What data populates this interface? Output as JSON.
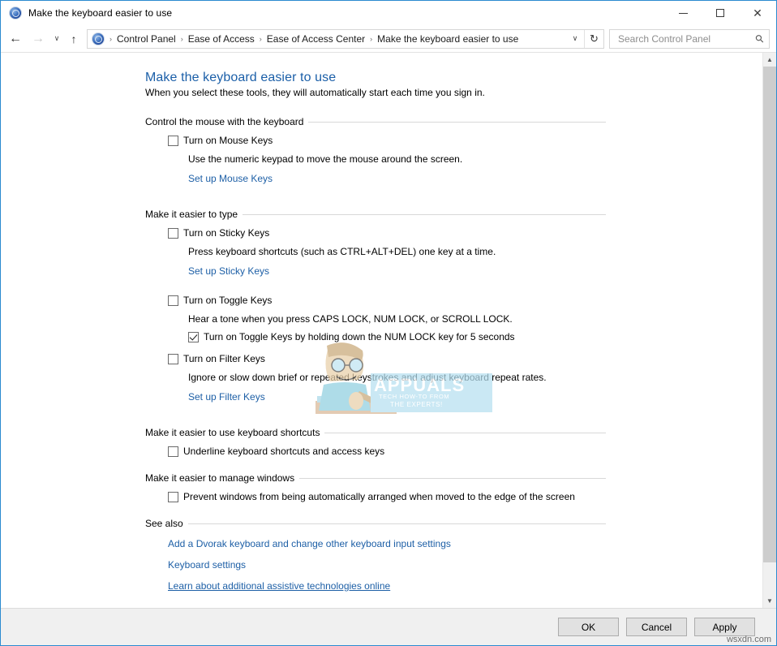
{
  "window": {
    "title": "Make the keyboard easier to use",
    "icon": "control-panel-icon",
    "minimize_label": "—",
    "maximize_label": "",
    "close_label": "✕"
  },
  "nav": {
    "back_label": "←",
    "forward_label": "→",
    "recent_label": "∨",
    "up_label": "↑",
    "separator": "›",
    "breadcrumbs": [
      "Control Panel",
      "Ease of Access",
      "Ease of Access Center",
      "Make the keyboard easier to use"
    ],
    "dropdown_label": "∨",
    "refresh_label": "↻"
  },
  "search": {
    "placeholder": "Search Control Panel",
    "value": "",
    "icon": "search-icon"
  },
  "main": {
    "title": "Make the keyboard easier to use",
    "subtitle": "When you select these tools, they will automatically start each time you sign in.",
    "sections": [
      {
        "heading": "Control the mouse with the keyboard",
        "checkbox_label": "Turn on Mouse Keys",
        "checked": false,
        "description": "Use the numeric keypad to move the mouse around the screen.",
        "link": "Set up Mouse Keys"
      },
      {
        "heading": "Make it easier to type",
        "checkbox_label": "Turn on Sticky Keys",
        "checked": false,
        "description": "Press keyboard shortcuts (such as CTRL+ALT+DEL) one key at a time.",
        "link": "Set up Sticky Keys"
      }
    ],
    "toggle_keys": {
      "checkbox_label": "Turn on Toggle Keys",
      "checked": false,
      "description": "Hear a tone when you press CAPS LOCK, NUM LOCK, or SCROLL LOCK.",
      "sub_checkbox_label": "Turn on Toggle Keys by holding down the NUM LOCK key for 5 seconds",
      "sub_checked": true
    },
    "filter_keys": {
      "checkbox_label": "Turn on Filter Keys",
      "checked": false,
      "description": "Ignore or slow down brief or repeated keystrokes and adjust keyboard repeat rates.",
      "link": "Set up Filter Keys"
    },
    "shortcuts_section": {
      "heading": "Make it easier to use keyboard shortcuts",
      "checkbox_label": "Underline keyboard shortcuts and access keys",
      "checked": false
    },
    "windows_section": {
      "heading": "Make it easier to manage windows",
      "checkbox_label": "Prevent windows from being automatically arranged when moved to the edge of the screen",
      "checked": false
    },
    "see_also": {
      "heading": "See also",
      "links": [
        "Add a Dvorak keyboard and change other keyboard input settings",
        "Keyboard settings",
        "Learn about additional assistive technologies online"
      ]
    }
  },
  "watermark": {
    "word": "APPUALS",
    "tagline1": "TECH HOW-TO FROM",
    "tagline2": "THE EXPERTS!"
  },
  "corner_watermark": "wsxdn.com",
  "footer": {
    "ok_label": "OK",
    "cancel_label": "Cancel",
    "apply_label": "Apply"
  },
  "scrollbar": {
    "up_label": "▲",
    "down_label": "▼"
  },
  "colors": {
    "window_border": "#2b8bd0",
    "title_link": "#1b5fa8",
    "link": "#1d5fa6",
    "footer_bg": "#f0f0f0"
  }
}
